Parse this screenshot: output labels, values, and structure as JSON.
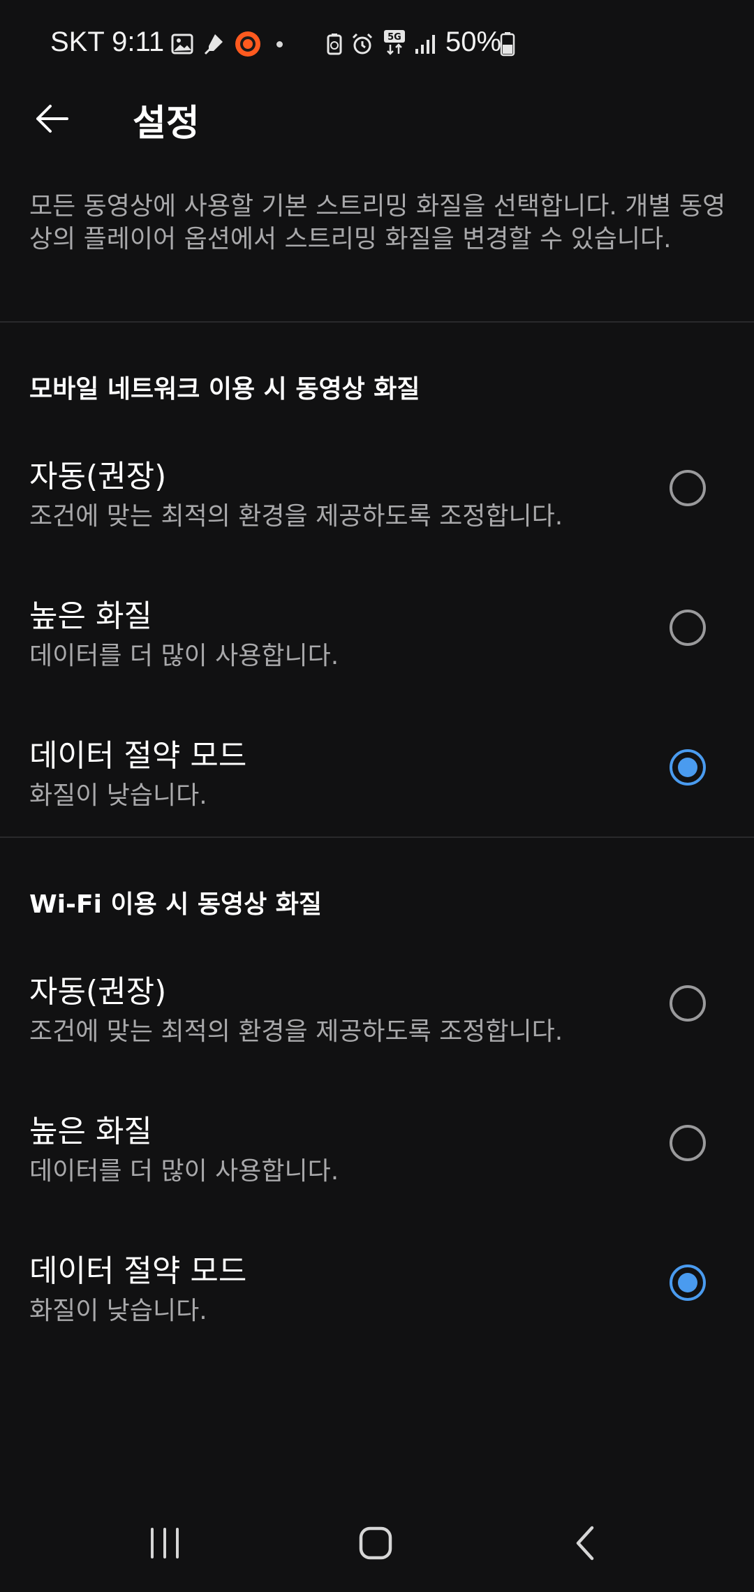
{
  "status_bar": {
    "time": "SKT 9:11",
    "battery": "50%",
    "icons": [
      "gallery-icon",
      "location-pin-icon",
      "record-icon",
      "battery-saver-icon",
      "alarm-icon",
      "5g-signal-icon",
      "cell-signal-icon",
      "battery-icon"
    ]
  },
  "app_bar": {
    "title": "설정"
  },
  "description": "모든 동영상에 사용할 기본 스트리밍 화질을 선택합니다. 개별 동영상의 플레이어 옵션에서 스트리밍 화질을 변경할 수 있습니다.",
  "sections": [
    {
      "header": "모바일 네트워크 이용 시 동영상 화질",
      "options": [
        {
          "title": "자동(권장)",
          "desc": "조건에 맞는 최적의 환경을 제공하도록 조정합니다.",
          "selected": false
        },
        {
          "title": "높은 화질",
          "desc": "데이터를 더 많이 사용합니다.",
          "selected": false
        },
        {
          "title": "데이터 절약 모드",
          "desc": "화질이 낮습니다.",
          "selected": true
        }
      ]
    },
    {
      "header": "Wi-Fi 이용 시 동영상 화질",
      "options": [
        {
          "title": "자동(권장)",
          "desc": "조건에 맞는 최적의 환경을 제공하도록 조정합니다.",
          "selected": false
        },
        {
          "title": "높은 화질",
          "desc": "데이터를 더 많이 사용합니다.",
          "selected": false
        },
        {
          "title": "데이터 절약 모드",
          "desc": "화질이 낮습니다.",
          "selected": true
        }
      ]
    }
  ],
  "colors": {
    "background": "#111112",
    "accent": "#4a9bef",
    "secondary_text": "#a9a9ab"
  },
  "nav_bar": {
    "icons": [
      "recents-icon",
      "home-icon",
      "back-icon"
    ]
  }
}
